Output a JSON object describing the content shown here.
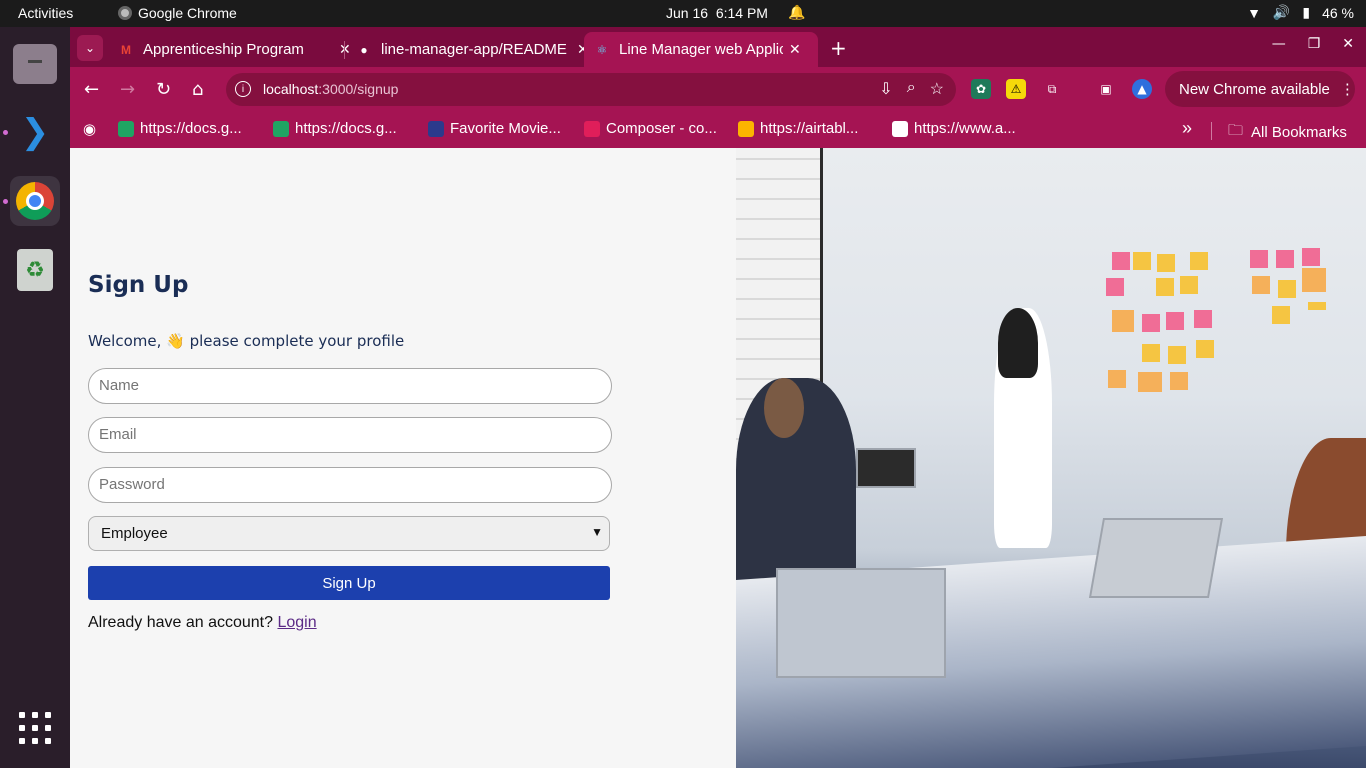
{
  "system": {
    "activities": "Activities",
    "app_name": "Google Chrome",
    "date": "Jun 16",
    "time": "6:14 PM",
    "battery": "46 %"
  },
  "tabs": [
    {
      "title": "Apprenticeship Program",
      "icon": "gmail-icon"
    },
    {
      "title": "line-manager-app/README",
      "icon": "github-icon"
    },
    {
      "title": "Line Manager web Application",
      "icon": "react-icon",
      "active": true
    }
  ],
  "toolbar": {
    "url_host": "localhost",
    "url_path": ":3000/signup",
    "new_chrome": "New Chrome available"
  },
  "bookmarks": [
    {
      "label": "https://docs.g...",
      "color": "#1fa463"
    },
    {
      "label": "https://docs.g...",
      "color": "#1fa463"
    },
    {
      "label": "Favorite Movie...",
      "color": "#2b3a8c"
    },
    {
      "label": "Composer - co...",
      "color": "#e01e5a"
    },
    {
      "label": "https://airtabl...",
      "color": "#fcb400"
    },
    {
      "label": "https://www.a...",
      "color": "#ffffff"
    }
  ],
  "bookmarks_all": "All Bookmarks",
  "form": {
    "title": "Sign Up",
    "welcome": "Welcome, 👋 please complete your profile",
    "name_placeholder": "Name",
    "email_placeholder": "Email",
    "password_placeholder": "Password",
    "role_selected": "Employee",
    "submit_label": "Sign Up",
    "already_text": "Already have an account?",
    "login_link": "Login"
  }
}
